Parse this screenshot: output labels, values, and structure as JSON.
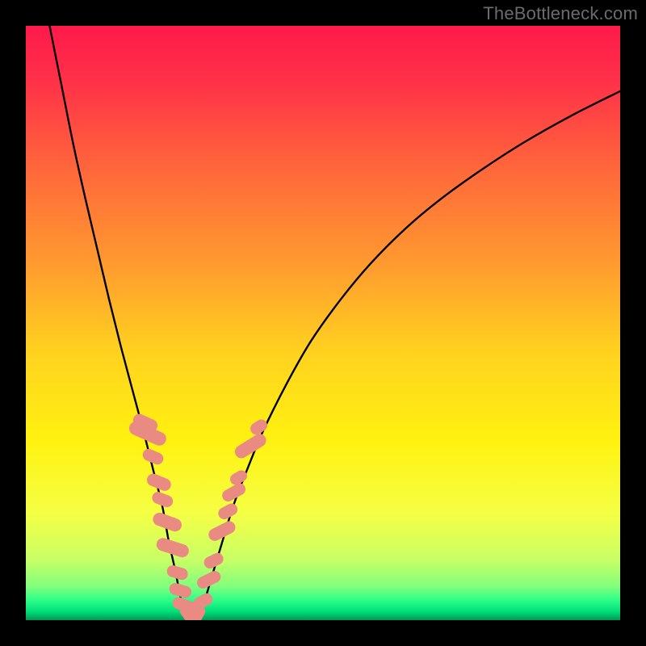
{
  "watermark": "TheBottleneck.com",
  "colors": {
    "frame": "#000000",
    "curve": "#000000",
    "marker_fill": "#e98b83",
    "gradient_stops": [
      {
        "offset": 0.0,
        "color": "#ff1a4b"
      },
      {
        "offset": 0.1,
        "color": "#ff3348"
      },
      {
        "offset": 0.25,
        "color": "#ff6a3a"
      },
      {
        "offset": 0.4,
        "color": "#ff9a2f"
      },
      {
        "offset": 0.55,
        "color": "#ffd21f"
      },
      {
        "offset": 0.7,
        "color": "#fff210"
      },
      {
        "offset": 0.82,
        "color": "#f5ff45"
      },
      {
        "offset": 0.9,
        "color": "#c7ff66"
      },
      {
        "offset": 0.945,
        "color": "#7dff7d"
      },
      {
        "offset": 0.965,
        "color": "#2fff88"
      },
      {
        "offset": 0.985,
        "color": "#00e07a"
      },
      {
        "offset": 1.0,
        "color": "#009a55"
      }
    ]
  },
  "chart_data": {
    "type": "line",
    "title": "",
    "xlabel": "",
    "ylabel": "",
    "xlim": [
      0,
      100
    ],
    "ylim": [
      0,
      100
    ],
    "series": [
      {
        "name": "curve-left",
        "x": [
          4.0,
          6.0,
          8.0,
          10.0,
          12.0,
          14.0,
          16.0,
          18.0,
          20.0,
          21.5,
          23.0,
          24.0,
          25.0,
          25.8,
          26.4,
          27.0
        ],
        "y": [
          100.0,
          90.0,
          80.0,
          71.0,
          62.5,
          54.0,
          46.0,
          38.5,
          31.0,
          25.0,
          19.0,
          13.5,
          9.0,
          5.0,
          2.0,
          0.2
        ]
      },
      {
        "name": "curve-right",
        "x": [
          29.0,
          30.0,
          31.5,
          33.0,
          35.0,
          37.5,
          40.0,
          44.0,
          48.0,
          53.0,
          58.0,
          64.0,
          70.0,
          77.0,
          84.0,
          92.0,
          100.0
        ],
        "y": [
          0.2,
          3.0,
          8.0,
          13.0,
          19.5,
          26.0,
          32.0,
          40.0,
          47.0,
          54.0,
          60.0,
          66.0,
          71.0,
          76.0,
          80.5,
          85.0,
          89.0
        ]
      }
    ],
    "plateau": {
      "x_start": 27.0,
      "x_end": 29.0,
      "y": 0.2
    },
    "markers": [
      {
        "x": 20.1,
        "y": 33.2,
        "w": 2.1,
        "h": 4.3,
        "rot": -66
      },
      {
        "x": 20.5,
        "y": 31.4,
        "w": 2.3,
        "h": 6.6,
        "rot": -66
      },
      {
        "x": 21.4,
        "y": 27.5,
        "w": 2.0,
        "h": 3.6,
        "rot": -67
      },
      {
        "x": 22.4,
        "y": 23.2,
        "w": 2.1,
        "h": 4.2,
        "rot": -68
      },
      {
        "x": 23.0,
        "y": 20.3,
        "w": 2.0,
        "h": 3.6,
        "rot": -69
      },
      {
        "x": 23.8,
        "y": 16.5,
        "w": 2.2,
        "h": 5.0,
        "rot": -70
      },
      {
        "x": 24.7,
        "y": 12.2,
        "w": 2.2,
        "h": 5.6,
        "rot": -72
      },
      {
        "x": 25.5,
        "y": 8.0,
        "w": 2.0,
        "h": 3.6,
        "rot": -73
      },
      {
        "x": 26.0,
        "y": 5.0,
        "w": 2.0,
        "h": 3.8,
        "rot": -74
      },
      {
        "x": 26.7,
        "y": 2.5,
        "w": 2.0,
        "h": 4.2,
        "rot": -70
      },
      {
        "x": 27.4,
        "y": 0.9,
        "w": 2.0,
        "h": 3.8,
        "rot": -35
      },
      {
        "x": 28.0,
        "y": 0.2,
        "w": 2.0,
        "h": 2.6,
        "rot": 0
      },
      {
        "x": 28.8,
        "y": 0.8,
        "w": 2.0,
        "h": 3.6,
        "rot": 30
      },
      {
        "x": 29.8,
        "y": 3.2,
        "w": 2.0,
        "h": 3.4,
        "rot": 62
      },
      {
        "x": 30.8,
        "y": 6.8,
        "w": 2.0,
        "h": 4.2,
        "rot": 64
      },
      {
        "x": 31.6,
        "y": 10.0,
        "w": 2.0,
        "h": 3.4,
        "rot": 64
      },
      {
        "x": 33.0,
        "y": 15.0,
        "w": 2.1,
        "h": 4.8,
        "rot": 63
      },
      {
        "x": 34.0,
        "y": 18.3,
        "w": 2.0,
        "h": 3.4,
        "rot": 62
      },
      {
        "x": 35.0,
        "y": 21.5,
        "w": 2.0,
        "h": 4.2,
        "rot": 61
      },
      {
        "x": 35.8,
        "y": 24.0,
        "w": 1.9,
        "h": 3.0,
        "rot": 60
      },
      {
        "x": 37.8,
        "y": 29.3,
        "w": 2.2,
        "h": 5.8,
        "rot": 58
      },
      {
        "x": 39.2,
        "y": 32.5,
        "w": 2.0,
        "h": 3.0,
        "rot": 57
      }
    ]
  }
}
